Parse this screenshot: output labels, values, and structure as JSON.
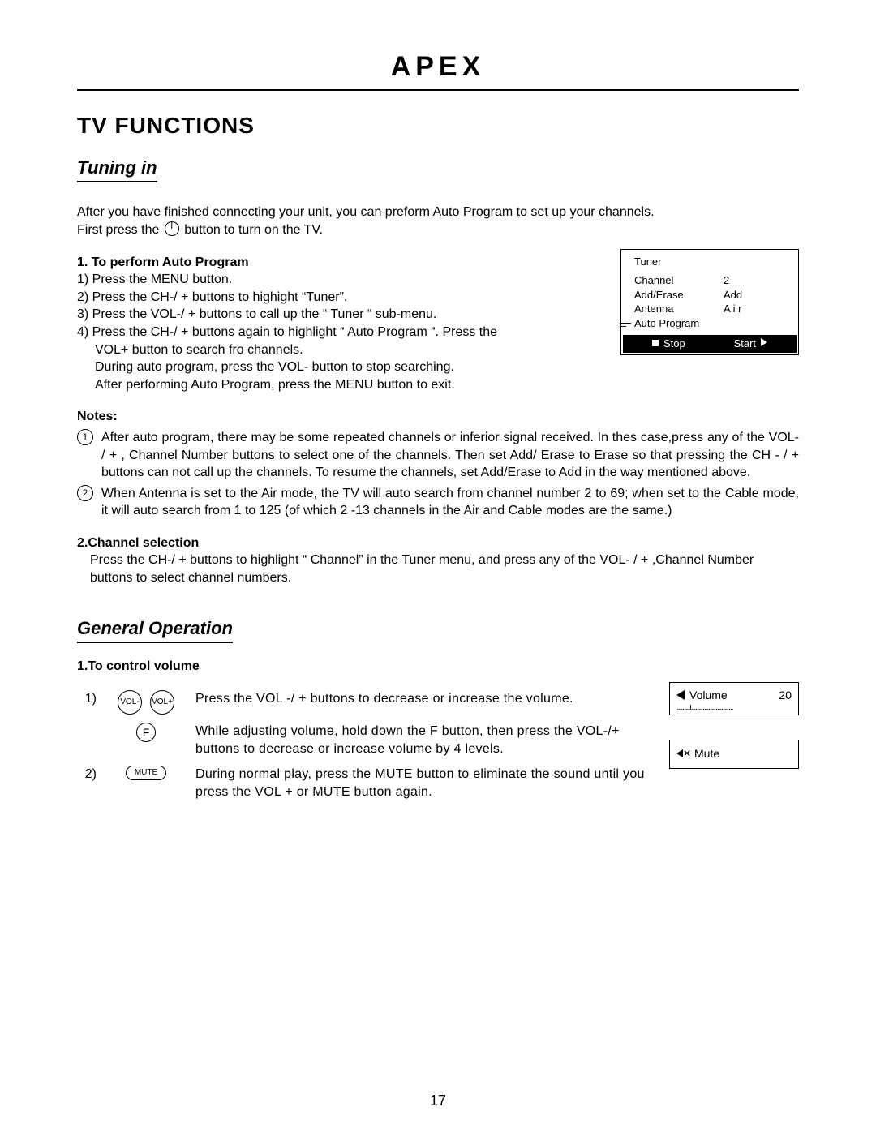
{
  "brand": "APEX",
  "section_title": "TV FUNCTIONS",
  "sub_tuning": "Tuning in",
  "intro1": "After you have finished connecting your unit, you can preform Auto Program to set up your channels.",
  "intro2a": "First press the ",
  "intro2b": " button to turn on the TV.",
  "auto_program": {
    "heading": "1. To perform Auto Program",
    "s1": "1) Press the MENU button.",
    "s2": "2) Press the CH-/ + buttons to highight “Tuner”.",
    "s3": "3) Press the VOL-/ + buttons to call up the “ Tuner “ sub-menu.",
    "s4": "4) Press the CH-/ + buttons again to highlight “ Auto Program “. Press the",
    "s4b": "VOL+ button to search fro channels.",
    "s5": "During auto program, press the VOL- button to stop searching.",
    "s6": "After performing Auto Program, press the MENU button to exit."
  },
  "osd_tuner": {
    "title": "Tuner",
    "rows": [
      {
        "k": "Channel",
        "v": "2"
      },
      {
        "k": "Add/Erase",
        "v": "Add"
      },
      {
        "k": "Antenna",
        "v": "A i r"
      },
      {
        "k": "Auto Program",
        "v": ""
      }
    ],
    "stop": "Stop",
    "start": "Start"
  },
  "notes_heading": "Notes:",
  "notes": {
    "n1": "After auto program, there may be some repeated channels or inferior signal received. In thes case,press any of the VOL- / + , Channel Number buttons to select one of the channels. Then set Add/ Erase to Erase so that pressing the CH - / + buttons can not call up the channels. To resume the channels, set Add/Erase to Add in the way mentioned above.",
    "n2": "When Antenna is set to the Air mode, the TV will auto search from channel number 2 to 69; when set to the Cable mode, it will auto search from 1 to 125 (of which 2 -13 channels in the Air and Cable modes are the same.)"
  },
  "channel_sel": {
    "heading": "2.Channel selection",
    "body": "Press the CH-/ + buttons to highlight “ Channel” in the Tuner menu, and press any of the VOL- / + ,Channel Number buttons to select channel numbers."
  },
  "sub_general": "General Operation",
  "vol_heading": "1.To control volume",
  "vol": {
    "idx1": "1)",
    "btn_minus": "VOL-",
    "btn_plus": "VOL+",
    "desc1": "Press the VOL -/ + buttons to decrease or increase the volume.",
    "btn_f": "F",
    "desc_f": "While adjusting volume, hold down the F button, then press the VOL-/+ buttons to decrease or increase volume by 4 levels.",
    "idx2": "2)",
    "btn_mute": "MUTE",
    "desc2": "During normal play, press the MUTE button to eliminate the sound until you press the VOL + or MUTE button again."
  },
  "osd_volume": {
    "label": "Volume",
    "value": "20",
    "bar": ".........I............................."
  },
  "osd_mute": {
    "label": "Mute"
  },
  "page_number": "17"
}
